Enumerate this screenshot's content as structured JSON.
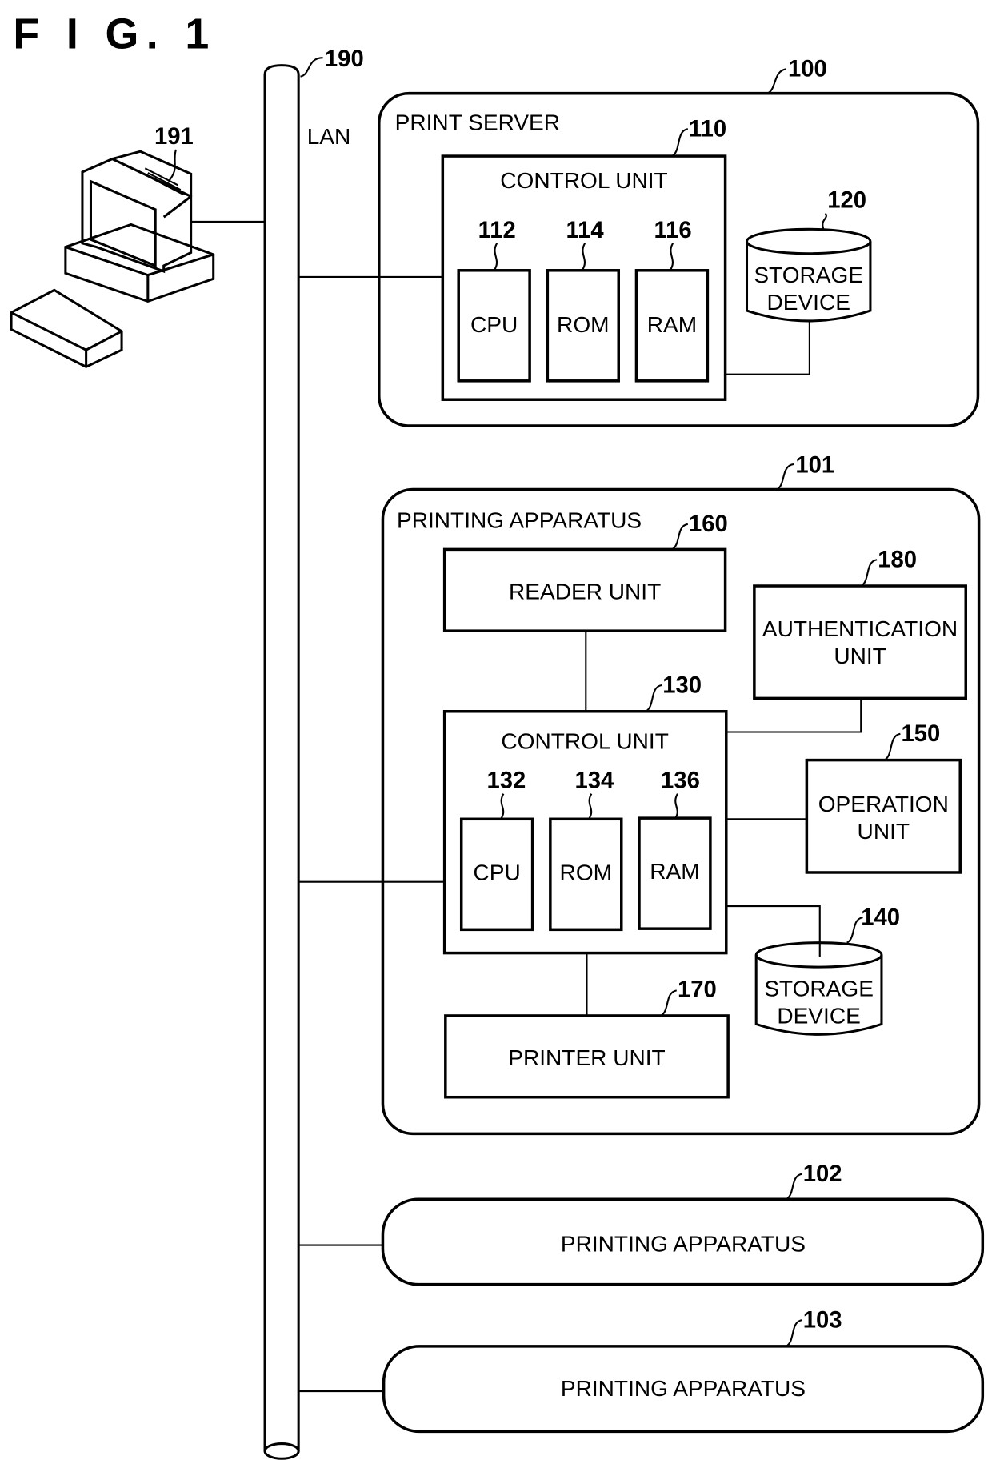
{
  "figure_title": "F I G. 1",
  "lan": {
    "ref": "190",
    "label": "LAN"
  },
  "computer": {
    "ref": "191"
  },
  "print_server": {
    "ref": "100",
    "label": "PRINT SERVER",
    "control_unit": {
      "ref": "110",
      "label": "CONTROL UNIT",
      "cpu": {
        "ref": "112",
        "label": "CPU"
      },
      "rom": {
        "ref": "114",
        "label": "ROM"
      },
      "ram": {
        "ref": "116",
        "label": "RAM"
      }
    },
    "storage": {
      "ref": "120",
      "line1": "STORAGE",
      "line2": "DEVICE"
    }
  },
  "printing_apparatus_main": {
    "ref": "101",
    "label": "PRINTING APPARATUS",
    "reader_unit": {
      "ref": "160",
      "label": "READER UNIT"
    },
    "authentication_unit": {
      "ref": "180",
      "line1": "AUTHENTICATION",
      "line2": "UNIT"
    },
    "control_unit": {
      "ref": "130",
      "label": "CONTROL UNIT",
      "cpu": {
        "ref": "132",
        "label": "CPU"
      },
      "rom": {
        "ref": "134",
        "label": "ROM"
      },
      "ram": {
        "ref": "136",
        "label": "RAM"
      }
    },
    "operation_unit": {
      "ref": "150",
      "line1": "OPERATION",
      "line2": "UNIT"
    },
    "storage": {
      "ref": "140",
      "line1": "STORAGE",
      "line2": "DEVICE"
    },
    "printer_unit": {
      "ref": "170",
      "label": "PRINTER UNIT"
    }
  },
  "printing_apparatus_2": {
    "ref": "102",
    "label": "PRINTING APPARATUS"
  },
  "printing_apparatus_3": {
    "ref": "103",
    "label": "PRINTING APPARATUS"
  }
}
